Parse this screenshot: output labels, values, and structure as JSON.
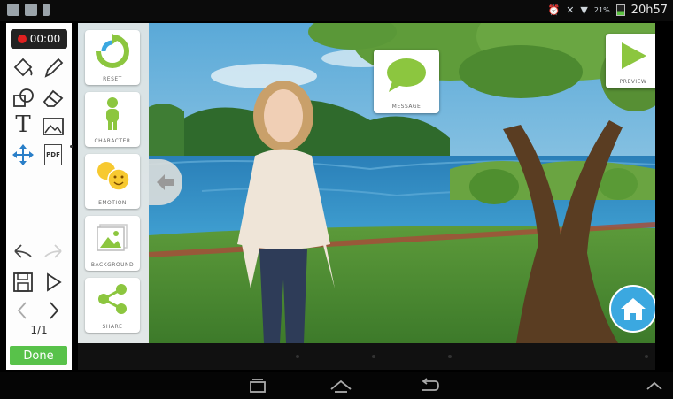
{
  "status_bar": {
    "battery": "21%",
    "time": "20h57",
    "icons": [
      "picture-icon",
      "keyboard-icon",
      "battery-small-icon",
      "alarm-icon",
      "mute-icon",
      "wifi-icon"
    ]
  },
  "toolbar": {
    "record_time": "00:00",
    "page_indicator": "1/1",
    "done_label": "Done",
    "pdf_label": "PDF",
    "text_tool_label": "T"
  },
  "menu": {
    "items": [
      {
        "label": "RESET",
        "icon": "reset-icon"
      },
      {
        "label": "CHARACTER",
        "icon": "character-icon"
      },
      {
        "label": "EMOTION",
        "icon": "emotion-icon"
      },
      {
        "label": "BACKGROUND",
        "icon": "background-icon"
      },
      {
        "label": "SHARE",
        "icon": "share-icon"
      }
    ]
  },
  "scene": {
    "message_label": "MESSAGE",
    "preview_label": "PREVIEW"
  },
  "colors": {
    "accent_green": "#8cc63f",
    "done_green": "#58c24a",
    "home_blue": "#3ba8e0",
    "record_red": "#e02020"
  }
}
